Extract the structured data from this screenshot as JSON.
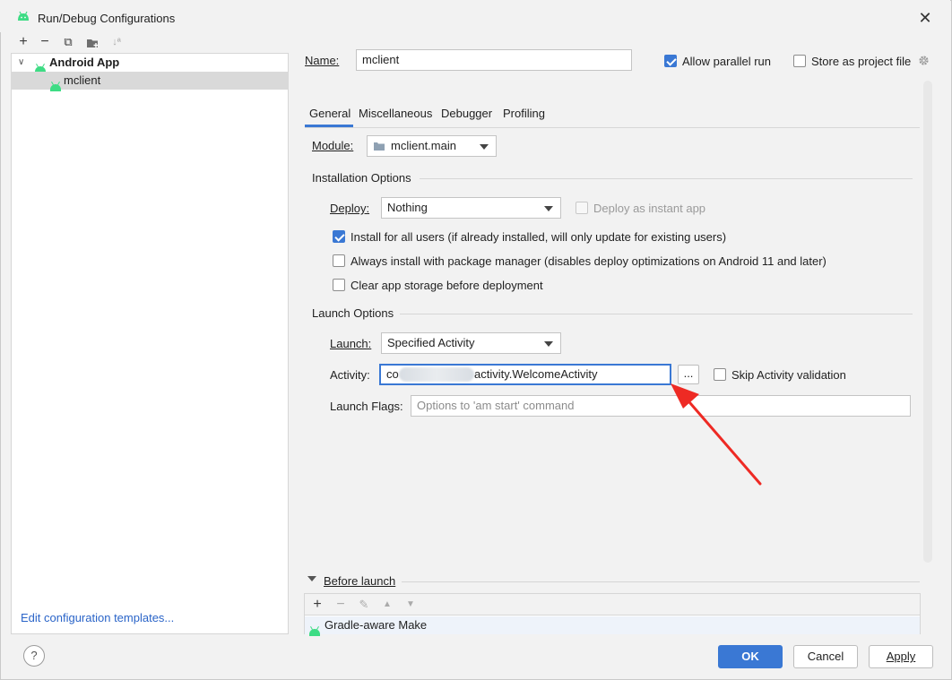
{
  "window": {
    "title": "Run/Debug Configurations"
  },
  "left": {
    "toolbar": {
      "add": "+",
      "remove": "−",
      "copy": "⧉",
      "folder": "▪",
      "sort": "↓ª"
    },
    "tree": [
      {
        "label": "Android App",
        "bold": true
      },
      {
        "label": "mclient",
        "selected": true
      }
    ],
    "edit_templates_link": "Edit configuration templates..."
  },
  "header": {
    "name_label": "Name:",
    "name_value": "mclient",
    "allow_parallel_label": "Allow parallel run",
    "allow_parallel_checked": true,
    "store_project_label": "Store as project file",
    "store_project_checked": false
  },
  "tabs": [
    "General",
    "Miscellaneous",
    "Debugger",
    "Profiling"
  ],
  "active_tab": "General",
  "general": {
    "module_label": "Module:",
    "module_value": "mclient.main",
    "installation_title": "Installation Options",
    "deploy_label": "Deploy:",
    "deploy_value": "Nothing",
    "instant_app_label": "Deploy as instant app",
    "install_all_users_label": "Install for all users (if already installed, will only update for existing users)",
    "install_all_users_checked": true,
    "always_install_label": "Always install with package manager (disables deploy optimizations on Android 11 and later)",
    "always_install_checked": false,
    "clear_storage_label": "Clear app storage before deployment",
    "clear_storage_checked": false,
    "launch_title": "Launch Options",
    "launch_label": "Launch:",
    "launch_value": "Specified Activity",
    "activity_label": "Activity:",
    "activity_value_prefix": "co",
    "activity_value_suffix": "activity.WelcomeActivity",
    "browse_label": "...",
    "skip_validation_label": "Skip Activity validation",
    "skip_validation_checked": false,
    "launch_flags_label": "Launch Flags:",
    "launch_flags_placeholder": "Options to 'am start' command"
  },
  "before_launch": {
    "title": "Before launch",
    "toolbar": {
      "add": "+",
      "remove": "−",
      "edit": "✎",
      "up": "▲",
      "down": "▼"
    },
    "items": [
      "Gradle-aware Make"
    ]
  },
  "footer": {
    "help": "?",
    "ok": "OK",
    "cancel": "Cancel",
    "apply": "Apply"
  },
  "colors": {
    "accent": "#3a78d4",
    "annotation_arrow": "#ee2a24",
    "android_green": "#3ddc84"
  }
}
